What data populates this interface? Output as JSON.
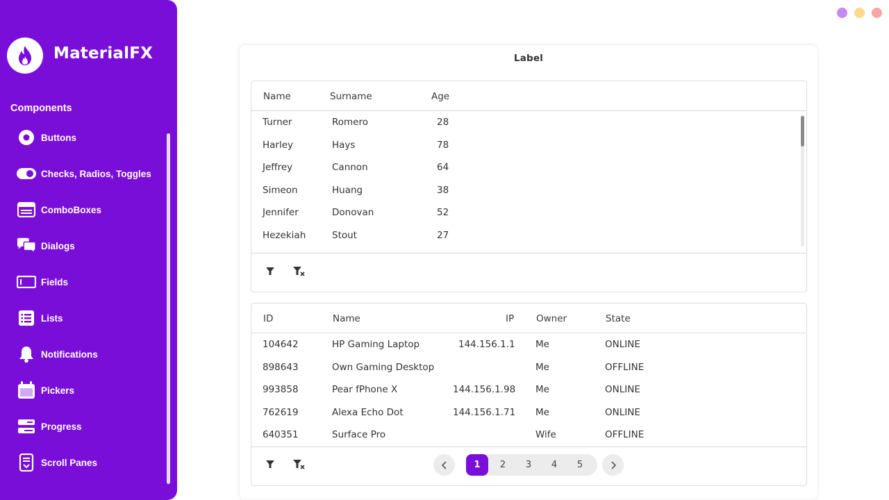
{
  "app": {
    "title": "MaterialFX"
  },
  "sidebar": {
    "section": "Components",
    "items": [
      {
        "label": "Buttons",
        "icon": "radio-button-icon"
      },
      {
        "label": "Checks, Radios, Toggles",
        "icon": "toggle-icon"
      },
      {
        "label": "ComboBoxes",
        "icon": "combobox-icon"
      },
      {
        "label": "Dialogs",
        "icon": "chat-bubbles-icon"
      },
      {
        "label": "Fields",
        "icon": "text-field-icon"
      },
      {
        "label": "Lists",
        "icon": "list-icon"
      },
      {
        "label": "Notifications",
        "icon": "bell-icon"
      },
      {
        "label": "Pickers",
        "icon": "calendar-icon"
      },
      {
        "label": "Progress",
        "icon": "progress-icon"
      },
      {
        "label": "Scroll Panes",
        "icon": "scroll-pane-icon"
      }
    ]
  },
  "window_controls": {
    "colors": [
      "#c58af2",
      "#fbd98f",
      "#f7a6a6"
    ]
  },
  "card": {
    "title": "Label"
  },
  "people_table": {
    "columns": [
      "Name",
      "Surname",
      "Age"
    ],
    "rows": [
      [
        "Turner",
        "Romero",
        "28"
      ],
      [
        "Harley",
        "Hays",
        "78"
      ],
      [
        "Jeffrey",
        "Cannon",
        "64"
      ],
      [
        "Simeon",
        "Huang",
        "38"
      ],
      [
        "Jennifer",
        "Donovan",
        "52"
      ],
      [
        "Hezekiah",
        "Stout",
        "27"
      ]
    ]
  },
  "devices_table": {
    "columns": [
      "ID",
      "Name",
      "IP",
      "Owner",
      "State"
    ],
    "rows": [
      [
        "104642",
        "HP Gaming Laptop",
        "144.156.1.1",
        "Me",
        "ONLINE"
      ],
      [
        "898643",
        "Own Gaming Desktop",
        "",
        "Me",
        "OFFLINE"
      ],
      [
        "993858",
        "Pear fPhone X",
        "144.156.1.98",
        "Me",
        "ONLINE"
      ],
      [
        "762619",
        "Alexa Echo Dot",
        "144.156.1.71",
        "Me",
        "ONLINE"
      ],
      [
        "640351",
        "Surface Pro",
        "",
        "Wife",
        "OFFLINE"
      ]
    ]
  },
  "pagination": {
    "pages": [
      "1",
      "2",
      "3",
      "4",
      "5"
    ],
    "current": "1"
  },
  "colors": {
    "accent": "#7a0ed9"
  }
}
